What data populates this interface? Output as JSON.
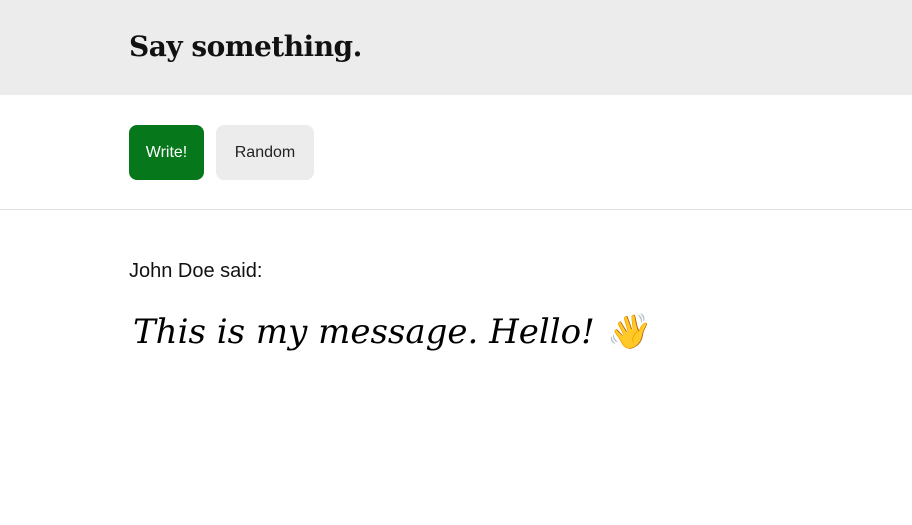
{
  "header": {
    "title": "Say something."
  },
  "toolbar": {
    "write_label": "Write!",
    "random_label": "Random",
    "write_color": "#06771a",
    "random_color": "#ececec"
  },
  "message": {
    "author_line": "John Doe said:",
    "text": "This is my message. Hello! 👋"
  }
}
